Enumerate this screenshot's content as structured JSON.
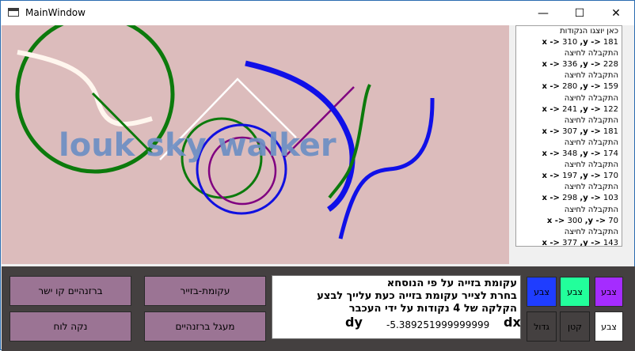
{
  "window": {
    "title": "MainWindow"
  },
  "titlebar": {
    "minimize_glyph": "—",
    "maximize_glyph": "☐",
    "close_glyph": "✕"
  },
  "canvas": {
    "background": "#dcbcbc",
    "watermark_text": "louk sky walker",
    "watermark_color": "#6d8fc4"
  },
  "log": {
    "header": "כאן יוצגו הנקודות",
    "entries": [
      {
        "x": "310",
        "y": "181",
        "label": "התקבלה לחיצה"
      },
      {
        "x": "336",
        "y": "228",
        "label": "התקבלה לחיצה"
      },
      {
        "x": "280",
        "y": "159",
        "label": "התקבלה לחיצה"
      },
      {
        "x": "241",
        "y": "122",
        "label": "התקבלה לחיצה"
      },
      {
        "x": "307",
        "y": "181",
        "label": "התקבלה לחיצה"
      },
      {
        "x": "348",
        "y": "174",
        "label": "התקבלה לחיצה"
      },
      {
        "x": "197",
        "y": "170",
        "label": "התקבלה לחיצה"
      },
      {
        "x": "298",
        "y": "103",
        "label": "התקבלה לחיצה"
      },
      {
        "x": "300",
        "y": "70",
        "label": "התקבלה לחיצה"
      },
      {
        "x": "377",
        "y": "143",
        "label": ""
      }
    ]
  },
  "buttons": {
    "straight_line": "ברזנהיים קו ישר",
    "bezier": "עקומת-בזייר",
    "clear_board": "נקה לוח",
    "circle": "מעגל ברזנהיים"
  },
  "info": {
    "line1": "עקומת בזייה על פי הנוסחא",
    "line2": "בחרת לצייר עקומת בזייה כעת עלייך לבצע",
    "line3": "הקלקה של 4 נקודות על ידי העכבר",
    "dy_label": "dy",
    "dx_value": "-5.389251999999999",
    "dx_label": "dx"
  },
  "colors": {
    "blue": {
      "label": "צבע",
      "hex": "#1f3dff"
    },
    "green": {
      "label": "צבע",
      "hex": "#22ff9b"
    },
    "purple": {
      "label": "צבע",
      "hex": "#a52cff"
    },
    "white": {
      "label": "צבע",
      "hex": "#ffffff"
    }
  },
  "size": {
    "large": "גדול",
    "small": "קטן"
  }
}
